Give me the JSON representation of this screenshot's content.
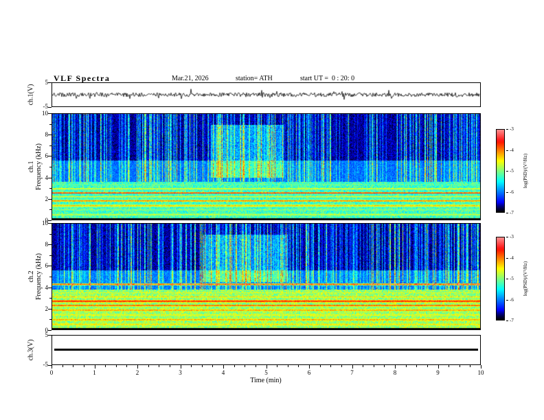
{
  "header": {
    "title": "VLF Spectra",
    "date": "Mar.21, 2026",
    "station": "station= ATH",
    "start_ut": "start UT =  0 : 20: 0"
  },
  "time_axis": {
    "label": "Time (min)",
    "min": 0,
    "max": 10,
    "major_ticks": [
      0,
      1,
      2,
      3,
      4,
      5,
      6,
      7,
      8,
      9,
      10
    ],
    "minor_step": 0.25
  },
  "colorbar": {
    "label": "log(PSD)/(V²/Hz)",
    "ticks": [
      "-3",
      "-4",
      "-5",
      "-6",
      "-7"
    ],
    "max": -3,
    "min": -7,
    "colormap": "jet"
  },
  "panels": {
    "ch1_wave": {
      "ylabel": "ch.1(V)",
      "ytop": "5",
      "ybottom": "-5"
    },
    "ch1_spec": {
      "ylabel1": "ch.1",
      "ylabel2": "Frequency (kHz)",
      "ymin": 0,
      "ymax": 10,
      "major_ticks": [
        0,
        2,
        4,
        6,
        8,
        10
      ],
      "minor_ticks": [
        1,
        3,
        5,
        7,
        9
      ]
    },
    "ch2_spec": {
      "ylabel1": "ch.2",
      "ylabel2": "Frequency (kHz)",
      "ymin": 0,
      "ymax": 10,
      "major_ticks": [
        0,
        2,
        4,
        6,
        8,
        10
      ],
      "minor_ticks": [
        1,
        3,
        5,
        7,
        9
      ]
    },
    "ch3_wave": {
      "ylabel": "ch.3(V)",
      "ytop": "5",
      "ybottom": "-5"
    }
  },
  "chart_data": [
    {
      "type": "line",
      "name": "ch1-waveform",
      "ylabel": "ch.1(V)",
      "ylim": [
        -5,
        5
      ],
      "xlim": [
        0,
        10
      ],
      "xlabel": "Time (min)",
      "summary": "continuous broadband noise oscillating about 0 V, ~±1.5 V",
      "seed": 5
    },
    {
      "type": "heatmap",
      "name": "ch1-spectrogram",
      "ylabel": "ch.1 Frequency (kHz)",
      "ylim": [
        0,
        10
      ],
      "xlim": [
        0,
        10
      ],
      "zlabel": "log(PSD)/(V²/Hz)",
      "zlim": [
        -7,
        -3
      ],
      "summary": "dense vertical sferic streaks above ~4 kHz on dark background; cyan-green noise and bright horizontal hum lines below ~3.5 kHz; brighter cyan patch ~3.7-5.4 min at 4-9 kHz; black band below 0.2 kHz",
      "seed": 11,
      "low_top": 3.6,
      "mid_top": 5.6,
      "base_low": -5.7,
      "rand_low": 0.9,
      "base_mid": -6.35,
      "rand_mid": 0.55,
      "base_high": -6.9,
      "rand_high": 0.45,
      "streak_density": 0.6,
      "bands": [
        {
          "f": 0.5,
          "w": 0.18,
          "v": -4.6
        },
        {
          "f": 0.95,
          "w": 0.14,
          "v": -4.8
        },
        {
          "f": 1.35,
          "w": 0.16,
          "v": -4.2
        },
        {
          "f": 1.8,
          "w": 0.1,
          "v": -3.8
        },
        {
          "f": 2.2,
          "w": 0.12,
          "v": -4.5
        },
        {
          "f": 2.55,
          "w": 0.07,
          "v": -3.3
        },
        {
          "f": 2.95,
          "w": 0.1,
          "v": -4.3
        },
        {
          "f": 3.35,
          "w": 0.1,
          "v": -4.9
        }
      ],
      "patch": {
        "t0": 0.37,
        "t1": 0.54,
        "f0": 4,
        "f1": 9,
        "boost": 1.1
      }
    },
    {
      "type": "heatmap",
      "name": "ch2-spectrogram",
      "ylabel": "ch.2 Frequency (kHz)",
      "ylim": [
        0,
        10
      ],
      "xlim": [
        0,
        10
      ],
      "zlabel": "log(PSD)/(V²/Hz)",
      "zlim": [
        -7,
        -3
      ],
      "summary": "similar to ch.1 with stronger green/yellow band structure below ~3.8 kHz, red hum line ~2.7 kHz and orange line ~4.3 kHz; bright cyan patch ~3.5-5.5 min at 4.5-9 kHz",
      "seed": 77,
      "low_top": 3.8,
      "mid_top": 5.6,
      "base_low": -5.4,
      "rand_low": 1.0,
      "base_mid": -6.3,
      "rand_mid": 0.55,
      "base_high": -6.9,
      "rand_high": 0.45,
      "streak_density": 0.6,
      "bands": [
        {
          "f": 0.5,
          "w": 0.18,
          "v": -4.3
        },
        {
          "f": 0.95,
          "w": 0.15,
          "v": -4.0
        },
        {
          "f": 1.4,
          "w": 0.16,
          "v": -4.4
        },
        {
          "f": 1.85,
          "w": 0.12,
          "v": -3.9
        },
        {
          "f": 2.3,
          "w": 0.1,
          "v": -3.6
        },
        {
          "f": 2.7,
          "w": 0.12,
          "v": -3.4
        },
        {
          "f": 3.1,
          "w": 0.1,
          "v": -4.2
        },
        {
          "f": 3.5,
          "w": 0.1,
          "v": -4.6
        },
        {
          "f": 4.3,
          "w": 0.08,
          "v": -3.8
        }
      ],
      "patch": {
        "t0": 0.35,
        "t1": 0.55,
        "f0": 4.5,
        "f1": 9,
        "boost": 1.0
      }
    },
    {
      "type": "line",
      "name": "ch3-waveform",
      "ylabel": "ch.3(V)",
      "ylim": [
        -5,
        5
      ],
      "xlim": [
        0,
        10
      ],
      "xlabel": "Time (min)",
      "summary": "flat thick line at 0 V (no signal)",
      "value": 0
    }
  ]
}
